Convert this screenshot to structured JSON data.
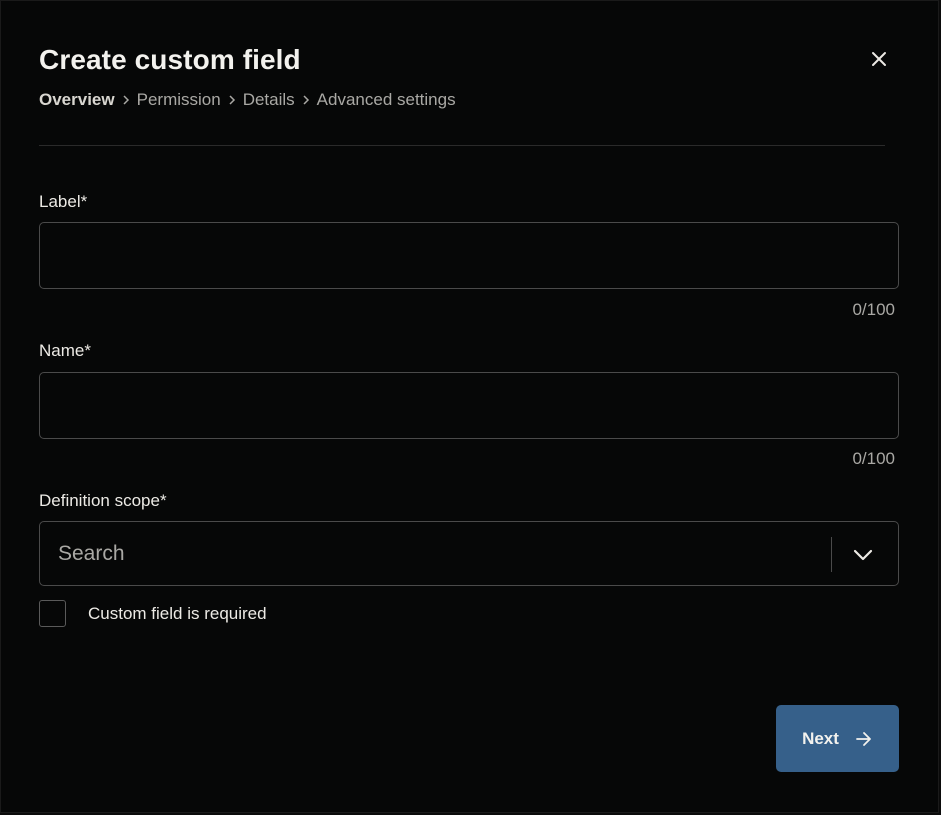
{
  "dialog": {
    "title": "Create custom field",
    "close_icon": "close-icon"
  },
  "breadcrumb": {
    "items": [
      {
        "label": "Overview",
        "active": true
      },
      {
        "label": "Permission",
        "active": false
      },
      {
        "label": "Details",
        "active": false
      },
      {
        "label": "Advanced settings",
        "active": false
      }
    ],
    "separator_icon": "chevron-right-icon"
  },
  "form": {
    "label_field": {
      "label": "Label*",
      "value": "",
      "counter": "0/100"
    },
    "name_field": {
      "label": "Name*",
      "value": "",
      "counter": "0/100"
    },
    "scope_field": {
      "label": "Definition scope*",
      "placeholder": "Search",
      "dropdown_icon": "chevron-down-icon"
    },
    "required_checkbox": {
      "label": "Custom field is required",
      "checked": false
    }
  },
  "footer": {
    "next_label": "Next",
    "next_icon": "arrow-right-icon"
  },
  "colors": {
    "background": "#060707",
    "primary_button": "#36608a",
    "border": "#4a4a4a",
    "text": "#eceae5",
    "muted_text": "#a9a8a4"
  }
}
